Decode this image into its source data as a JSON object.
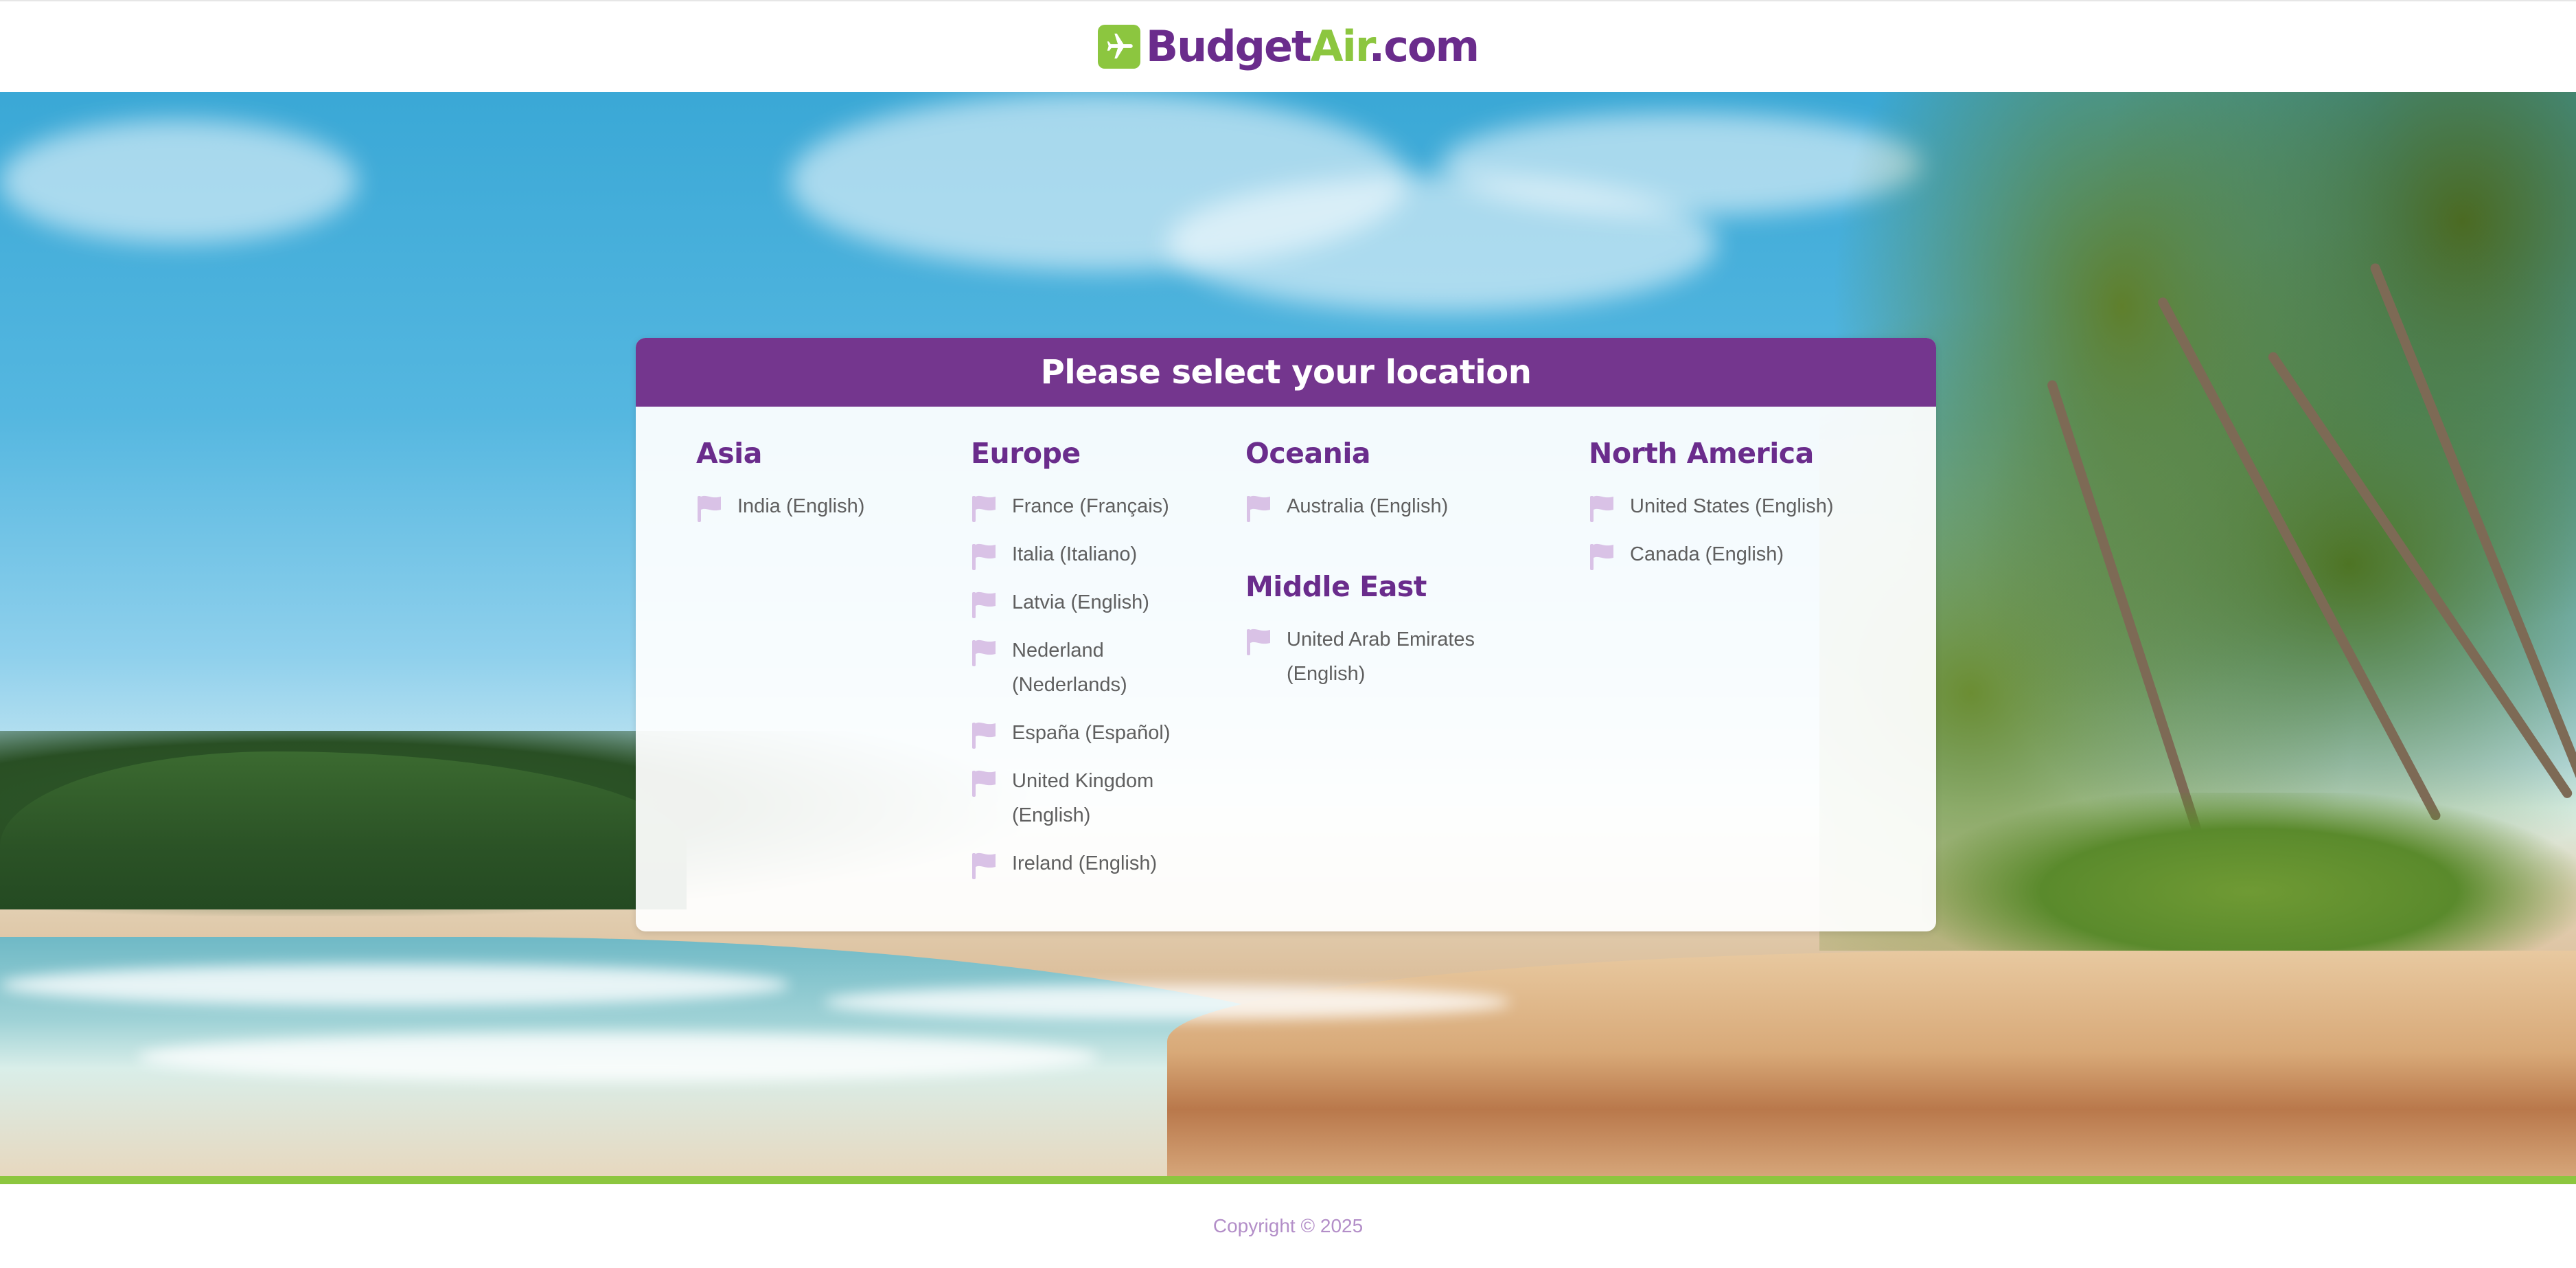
{
  "header": {
    "logo_part1": "Budget",
    "logo_part2": "Air",
    "logo_part3": ".com",
    "logo_icon": "airplane-icon"
  },
  "panel": {
    "title": "Please select your location",
    "regions": {
      "asia": {
        "title": "Asia",
        "items": [
          "India (English)"
        ]
      },
      "europe": {
        "title": "Europe",
        "items": [
          "France (Français)",
          "Italia (Italiano)",
          "Latvia (English)",
          "Nederland (Nederlands)",
          "España (Español)",
          "United Kingdom (English)",
          "Ireland (English)"
        ]
      },
      "oceania": {
        "title": "Oceania",
        "items": [
          "Australia (English)"
        ]
      },
      "middle_east": {
        "title": "Middle East",
        "items": [
          "United Arab Emirates (English)"
        ]
      },
      "north_america": {
        "title": "North America",
        "items": [
          "United States (English)",
          "Canada (English)"
        ]
      }
    },
    "item_icon": "flag-icon"
  },
  "footer": {
    "copyright": "Copyright © 2025"
  },
  "colors": {
    "brand_purple": "#74368e",
    "brand_green": "#8cc63f",
    "flag_lilac": "#d9c2e6",
    "link_gray": "#5f5f5f"
  }
}
